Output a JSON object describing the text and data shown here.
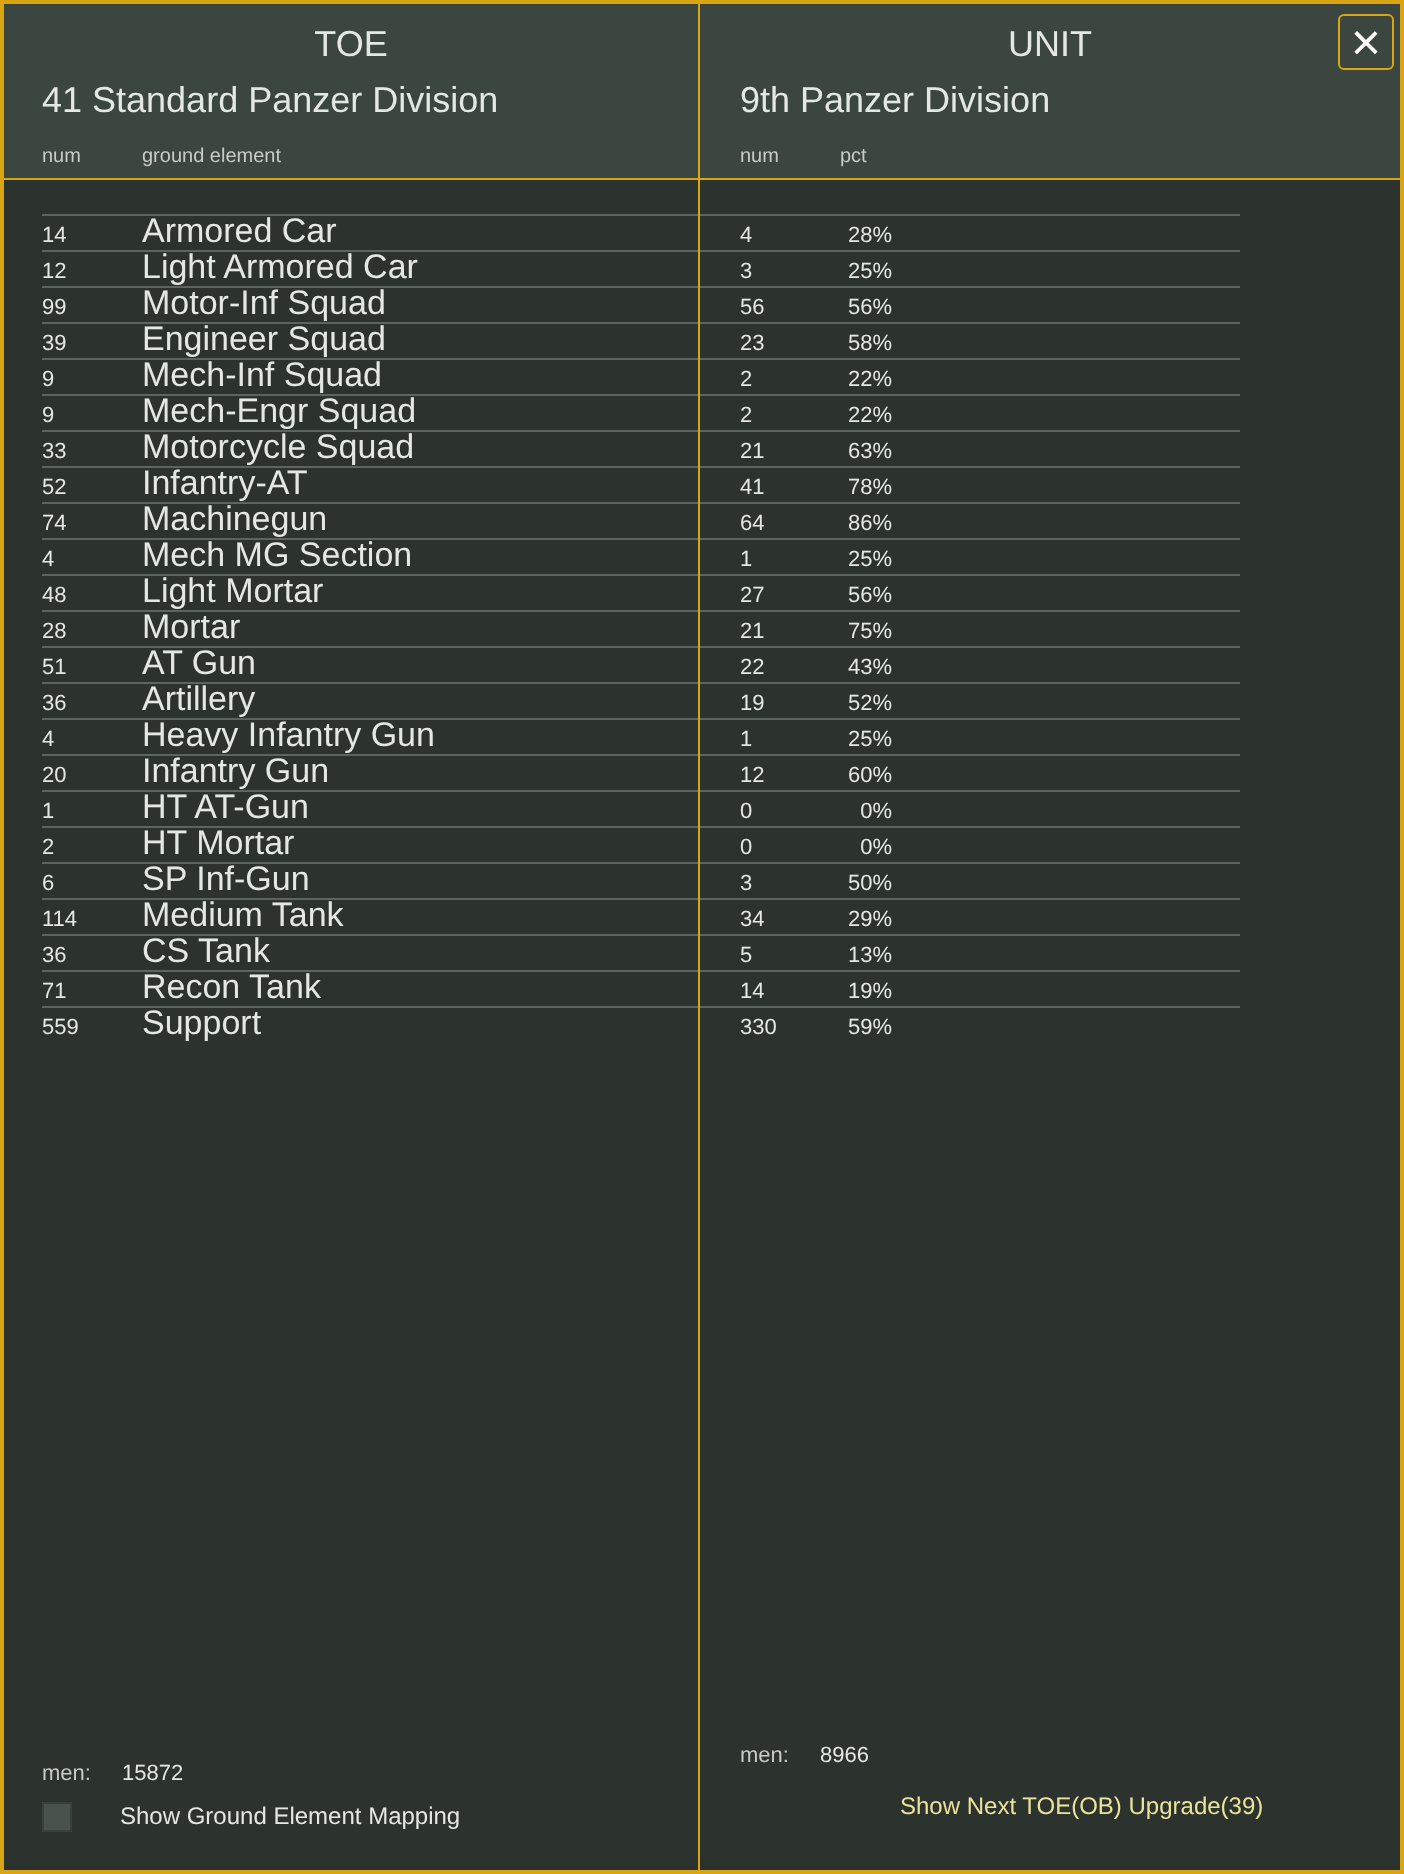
{
  "toe": {
    "heading": "TOE",
    "name": "41 Standard Panzer Division",
    "columns": [
      "num",
      "ground element"
    ],
    "men_label": "men:",
    "men": "15872",
    "mapping": {
      "label": "Show Ground Element Mapping",
      "checked": false
    }
  },
  "unit": {
    "heading": "UNIT",
    "name": "9th Panzer Division",
    "columns": [
      "num",
      "pct"
    ],
    "men_label": "men:",
    "men": "8966",
    "upgrade_link": "Show Next TOE(OB) Upgrade(39)"
  },
  "close_button": "×",
  "rows": [
    {
      "num": "14",
      "element": "Armored Car",
      "unit_num": "4",
      "pct": "28%"
    },
    {
      "num": "12",
      "element": "Light Armored Car",
      "unit_num": "3",
      "pct": "25%"
    },
    {
      "num": "99",
      "element": "Motor-Inf Squad",
      "unit_num": "56",
      "pct": "56%"
    },
    {
      "num": "39",
      "element": "Engineer Squad",
      "unit_num": "23",
      "pct": "58%"
    },
    {
      "num": "9",
      "element": "Mech-Inf Squad",
      "unit_num": "2",
      "pct": "22%"
    },
    {
      "num": "9",
      "element": "Mech-Engr Squad",
      "unit_num": "2",
      "pct": "22%"
    },
    {
      "num": "33",
      "element": "Motorcycle Squad",
      "unit_num": "21",
      "pct": "63%"
    },
    {
      "num": "52",
      "element": "Infantry-AT",
      "unit_num": "41",
      "pct": "78%"
    },
    {
      "num": "74",
      "element": "Machinegun",
      "unit_num": "64",
      "pct": "86%"
    },
    {
      "num": "4",
      "element": "Mech MG Section",
      "unit_num": "1",
      "pct": "25%"
    },
    {
      "num": "48",
      "element": "Light Mortar",
      "unit_num": "27",
      "pct": "56%"
    },
    {
      "num": "28",
      "element": "Mortar",
      "unit_num": "21",
      "pct": "75%"
    },
    {
      "num": "51",
      "element": "AT Gun",
      "unit_num": "22",
      "pct": "43%"
    },
    {
      "num": "36",
      "element": "Artillery",
      "unit_num": "19",
      "pct": "52%"
    },
    {
      "num": "4",
      "element": "Heavy Infantry Gun",
      "unit_num": "1",
      "pct": "25%"
    },
    {
      "num": "20",
      "element": "Infantry Gun",
      "unit_num": "12",
      "pct": "60%"
    },
    {
      "num": "1",
      "element": "HT AT-Gun",
      "unit_num": "0",
      "pct": "0%"
    },
    {
      "num": "2",
      "element": "HT Mortar",
      "unit_num": "0",
      "pct": "0%"
    },
    {
      "num": "6",
      "element": "SP Inf-Gun",
      "unit_num": "3",
      "pct": "50%"
    },
    {
      "num": "114",
      "element": "Medium Tank",
      "unit_num": "34",
      "pct": "29%"
    },
    {
      "num": "36",
      "element": "CS Tank",
      "unit_num": "5",
      "pct": "13%"
    },
    {
      "num": "71",
      "element": "Recon Tank",
      "unit_num": "14",
      "pct": "19%"
    },
    {
      "num": "559",
      "element": "Support",
      "unit_num": "330",
      "pct": "59%"
    }
  ]
}
